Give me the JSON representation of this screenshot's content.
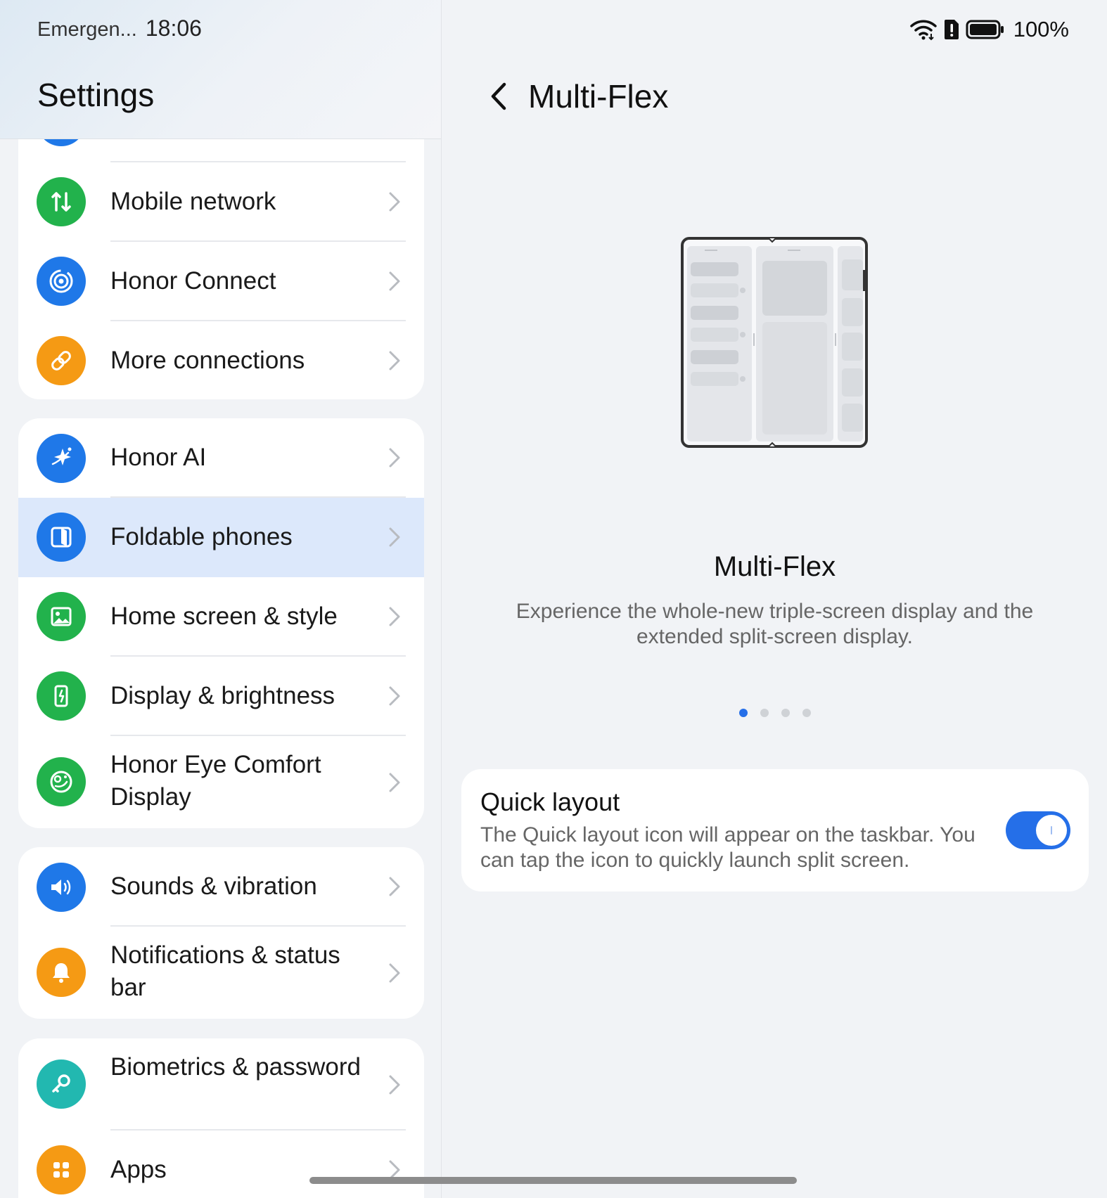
{
  "status_bar": {
    "carrier": "Emergen...",
    "time": "18:06",
    "battery_percent": "100%",
    "icons": [
      "wifi-icon",
      "alert-sim-icon",
      "battery-icon"
    ]
  },
  "left": {
    "title": "Settings",
    "groups": [
      {
        "items": [
          {
            "label": "Mobile network",
            "icon": "mobile-data-icon",
            "color": "#22b24c"
          },
          {
            "label": "Honor Connect",
            "icon": "honor-connect-icon",
            "color": "#1f78e8"
          },
          {
            "label": "More connections",
            "icon": "link-icon",
            "color": "#f59a14"
          }
        ]
      },
      {
        "items": [
          {
            "label": "Honor AI",
            "icon": "sparkle-icon",
            "color": "#1f78e8"
          },
          {
            "label": "Foldable phones",
            "icon": "foldable-icon",
            "color": "#1f78e8",
            "selected": true
          },
          {
            "label": "Home screen & style",
            "icon": "image-icon",
            "color": "#22b24c"
          },
          {
            "label": "Display & brightness",
            "icon": "phone-brightness-icon",
            "color": "#22b24c"
          },
          {
            "label": "Honor Eye Comfort Display",
            "icon": "eye-comfort-icon",
            "color": "#22b24c"
          }
        ]
      },
      {
        "items": [
          {
            "label": "Sounds & vibration",
            "icon": "speaker-icon",
            "color": "#1f78e8"
          },
          {
            "label": "Notifications & status bar",
            "icon": "bell-icon",
            "color": "#f59a14"
          }
        ]
      },
      {
        "items": [
          {
            "label": "Biometrics & password",
            "icon": "key-icon",
            "color": "#22b8b0"
          },
          {
            "label": "Apps",
            "icon": "apps-grid-icon",
            "color": "#f59a14"
          }
        ]
      }
    ]
  },
  "right": {
    "title": "Multi-Flex",
    "feature": {
      "title": "Multi-Flex",
      "description": "Experience the whole-new triple-screen display and the extended split-screen display.",
      "page_count": 4,
      "active_page": 1
    },
    "quick_layout": {
      "title": "Quick layout",
      "description": "The Quick layout icon will appear on the taskbar. You can tap the icon to quickly launch split screen.",
      "enabled": true
    }
  },
  "colors": {
    "accent": "#256fe8",
    "selected_row": "#dce8fb",
    "background": "#f1f3f6"
  }
}
